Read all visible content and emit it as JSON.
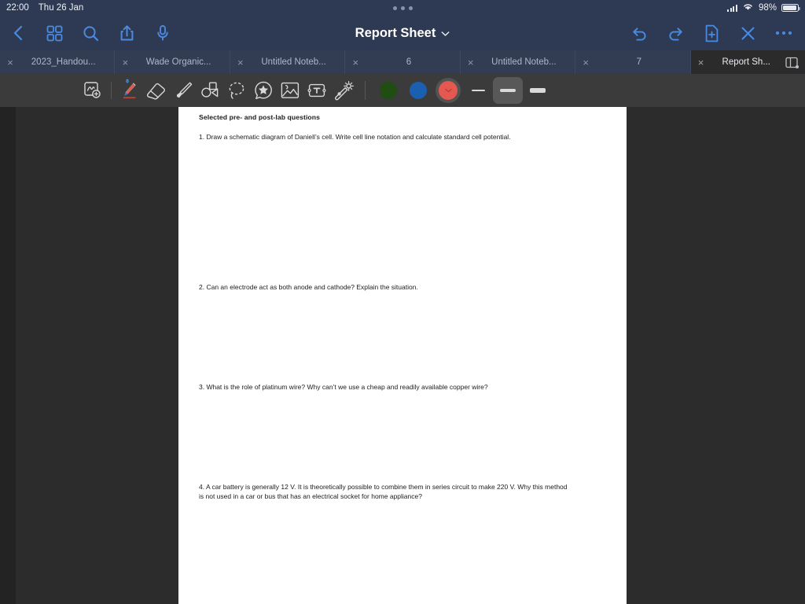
{
  "status_bar": {
    "time": "22:00",
    "date": "Thu 26 Jan",
    "battery_percent": "98%",
    "wifi_icon": "wifi-icon",
    "signal_icon": "cellular-signal-icon",
    "battery_icon": "battery-icon",
    "multitask_handle": "multitask-dots-icon"
  },
  "header": {
    "back_icon": "chevron-left-icon",
    "grid_icon": "grid-view-icon",
    "search_icon": "search-icon",
    "share_icon": "share-icon",
    "mic_icon": "microphone-icon",
    "title": "Report Sheet",
    "title_chevron": "chevron-down-icon",
    "undo_icon": "undo-icon",
    "redo_icon": "redo-icon",
    "add_page_icon": "add-page-icon",
    "close_icon": "close-x-icon",
    "more_icon": "more-horizontal-icon",
    "accent_color": "#4a8ae0"
  },
  "tabs": [
    {
      "label": "2023_Handou...",
      "close": "×",
      "active": false
    },
    {
      "label": "Wade Organic...",
      "close": "×",
      "active": false
    },
    {
      "label": "Untitled Noteb...",
      "close": "×",
      "active": false
    },
    {
      "label": "6",
      "close": "×",
      "active": false
    },
    {
      "label": "Untitled Noteb...",
      "close": "×",
      "active": false
    },
    {
      "label": "7",
      "close": "×",
      "active": false
    },
    {
      "label": "Report Sh...",
      "close": "×",
      "active": true
    }
  ],
  "tab_bar": {
    "split_view_icon": "split-view-icon"
  },
  "toolbar": {
    "tools": [
      {
        "name": "zoom-write-tool-icon",
        "selected": false
      },
      {
        "name": "pen-tool-icon",
        "selected": true,
        "badge": "bluetooth-icon"
      },
      {
        "name": "eraser-tool-icon",
        "selected": false
      },
      {
        "name": "highlighter-tool-icon",
        "selected": false
      },
      {
        "name": "shapes-tool-icon",
        "selected": false
      },
      {
        "name": "lasso-tool-icon",
        "selected": false
      },
      {
        "name": "sticker-tool-icon",
        "selected": false
      },
      {
        "name": "image-tool-icon",
        "selected": false
      },
      {
        "name": "text-box-tool-icon",
        "selected": false
      },
      {
        "name": "magic-wand-tool-icon",
        "selected": false
      }
    ],
    "colors": [
      {
        "name": "color-swatch-green",
        "hex": "#1f4d12",
        "selected": false
      },
      {
        "name": "color-swatch-blue",
        "hex": "#1b5fb0",
        "selected": false
      },
      {
        "name": "color-swatch-red",
        "hex": "#e4584f",
        "selected": true,
        "chevron": "chevron-down-icon"
      }
    ],
    "thickness": [
      {
        "name": "stroke-thin",
        "height": 2,
        "width": 17,
        "selected": false
      },
      {
        "name": "stroke-medium",
        "height": 4,
        "width": 20,
        "selected": true
      },
      {
        "name": "stroke-thick",
        "height": 6,
        "width": 20,
        "selected": false
      }
    ]
  },
  "document": {
    "heading": "Selected pre- and post-lab questions",
    "questions": [
      "1. Draw a schematic diagram of Daniell’s cell.  Write cell line notation and calculate standard cell potential.",
      "2. Can an electrode act as both anode and cathode?  Explain the situation.",
      "3. What is the role of platinum wire?  Why can’t we use a cheap and readily available copper wire?",
      "4. A car battery is generally 12 V.  It is theoretically possible to combine them in series circuit to make 220 V. Why this method is not used in a car or bus that has an electrical socket for home appliance?"
    ]
  }
}
